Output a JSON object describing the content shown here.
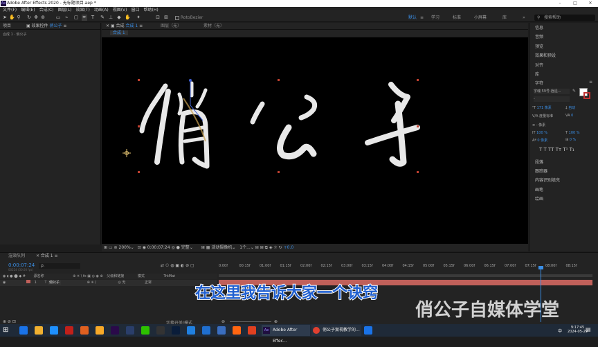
{
  "window": {
    "title": "Adobe After Effects 2020 - 无标题项目.aep *",
    "app_icon": "Ae",
    "minimize": "–",
    "maximize": "□",
    "close": "✕"
  },
  "menu": [
    "文件(F)",
    "编辑(E)",
    "合成(C)",
    "图层(L)",
    "效果(T)",
    "动画(A)",
    "视图(V)",
    "窗口",
    "帮助(H)"
  ],
  "toolbar": {
    "rotobezier": "RotoBezier",
    "workspaces": [
      "默认",
      "≡",
      "学习",
      "标准",
      "小屏幕",
      "库",
      "»"
    ],
    "search_placeholder": "搜索帮助"
  },
  "left_panel": {
    "tab_project": "项目",
    "tab_effects": "效果控件",
    "effects_layer": "俏公子",
    "breadcrumb": "合成 1 · 俏公子"
  },
  "viewer": {
    "tab_comp": "合成",
    "comp_name": "合成 1",
    "tab_layer": "图层（无）",
    "tab_footage": "素材（无）",
    "comp_label": "合成 1"
  },
  "viewer_bar": {
    "zoom": "200%",
    "timecode": "0:00:07:24",
    "quality": "完整",
    "camera": "活动摄像机",
    "views": "1个...",
    "exposure": "+0.0"
  },
  "right_panel": {
    "items": [
      "信息",
      "音频",
      "预览",
      "效果和预设",
      "对齐",
      "库"
    ],
    "char_title": "字符",
    "font": "字魂 59号-逍遥...",
    "style": "-",
    "size": "171 像素",
    "leading": "自动",
    "kerning": "度量标准",
    "tracking": "0",
    "stroke": "- 像素",
    "vscale": "100 %",
    "hscale": "100 %",
    "baseline": "0 像素",
    "tsume": "0 %",
    "styles": [
      "T",
      "T",
      "TT",
      "Tт",
      "T¹",
      "T₁"
    ],
    "items2": [
      "段落",
      "跟踪器",
      "内容识别填充",
      "画笔",
      "绘画"
    ]
  },
  "timeline": {
    "tab_render": "渲染队列",
    "tab_comp": "合成 1",
    "timecode": "0:00:07:24",
    "frame_info": "00224 (30.00 fps)",
    "search_placeholder": "ρ.",
    "col_source": "源名称",
    "col_parent": "父级和链接",
    "col_mode": "模式",
    "col_trkmat": "TrkMat",
    "layer_num": "1",
    "layer_name": "俏公子",
    "layer_parent": "无",
    "layer_mode": "正常",
    "ruler": [
      "0:00f",
      "00:15f",
      "01:00f",
      "01:15f",
      "02:00f",
      "02:15f",
      "03:00f",
      "03:15f",
      "04:00f",
      "04:15f",
      "05:00f",
      "05:15f",
      "06:00f",
      "06:15f",
      "07:00f",
      "07:15f",
      "08:00f",
      "08:15f"
    ],
    "toggle_label": "切换开关/模式"
  },
  "subtitle": "在这里我告诉大家一个诀窍",
  "watermark": "俏公子自媒体学堂",
  "taskbar": {
    "task_ae": "Adobe After Effec...",
    "task_chrome": "俏公子案视教学的...",
    "clock": "9:17:45",
    "date": "2024-05-29",
    "ime": "中"
  },
  "colors": {
    "accent": "#3a8ee6",
    "subtitle_fill": "#1f5fd0",
    "layer_bar": "#c0605a",
    "playhead": "#3a8ee6"
  }
}
